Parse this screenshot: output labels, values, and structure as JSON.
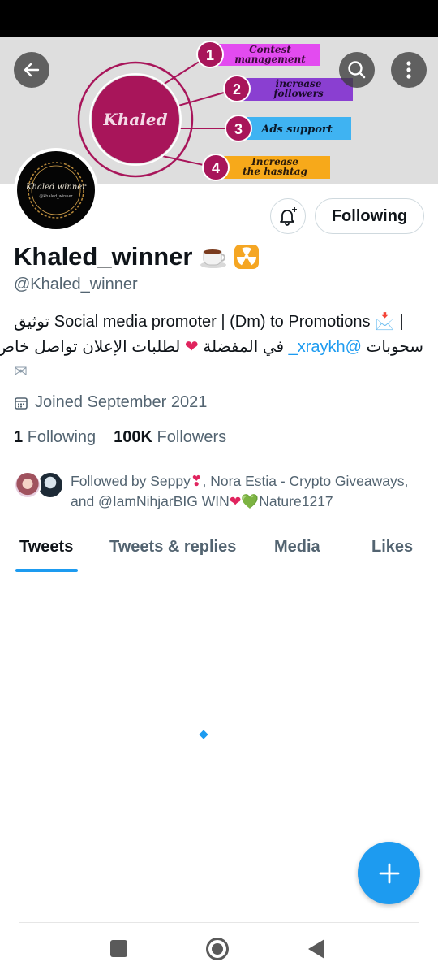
{
  "banner": {
    "center_label": "Khaled",
    "items": [
      {
        "number": "1",
        "text_line1": "Contest",
        "text_line2": "management",
        "color": "#e34bf0"
      },
      {
        "number": "2",
        "text_line1": "increase",
        "text_line2": "followers",
        "color": "#8a3fd1"
      },
      {
        "number": "3",
        "text_line1": "Ads support",
        "text_line2": "",
        "color": "#3fb3f2"
      },
      {
        "number": "4",
        "text_line1": "Increase",
        "text_line2": "the hashtag",
        "color": "#f7a91a"
      }
    ],
    "accent_color": "#a8155a"
  },
  "toolbar": {
    "back_icon": "back-arrow-icon",
    "search_icon": "search-icon",
    "more_icon": "more-vertical-icon"
  },
  "avatar": {
    "name_text": "Khaled winner",
    "handle_text": "@khaled_winner"
  },
  "actions": {
    "notify_icon": "bell-add-icon",
    "following_label": "Following"
  },
  "profile": {
    "display_name": "Khaled_winner",
    "handle": "@Khaled_winner",
    "bio_line1": "توثيق Social media promoter | (Dm) to Promotions 📩 |",
    "bio_line2_before": "سحوبات ",
    "bio_line2_mention": "@xraykh_",
    "bio_line2_after": " في المفضلة ",
    "bio_line2_heart": "❤",
    "bio_line2_end": " لطلبات الإعلان تواصل خاص",
    "bio_line3": "✉",
    "joined": "Joined September 2021",
    "following_count": "1",
    "following_label": "Following",
    "followers_count": "100K",
    "followers_label": "Followers"
  },
  "followed_by": {
    "prefix": "Followed by Seppy",
    "heart1": "❣",
    "middle": ", Nora Estia - Crypto Giveaways, and @IamNihjarBIG WIN",
    "heart2": "❤",
    "heart3": "💚",
    "suffix": "Nature1217"
  },
  "tabs": [
    {
      "label": "Tweets",
      "active": true
    },
    {
      "label": "Tweets & replies",
      "active": false
    },
    {
      "label": "Media",
      "active": false
    },
    {
      "label": "Likes",
      "active": false
    }
  ],
  "fab": {
    "icon": "plus-icon"
  },
  "colors": {
    "accent": "#1d9bf0",
    "text": "#0f1419",
    "secondary": "#536471"
  }
}
